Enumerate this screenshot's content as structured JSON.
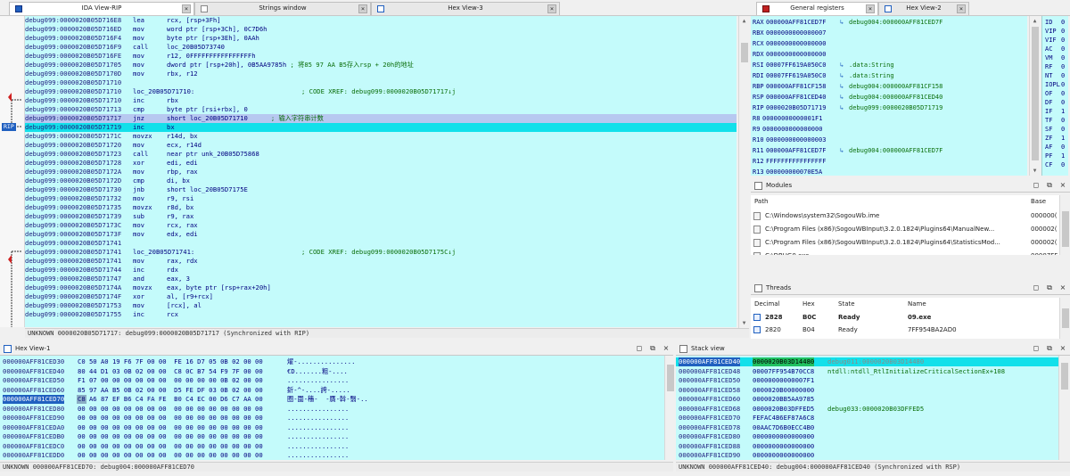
{
  "tabs_left": [
    {
      "label": "IDA View-RIP",
      "icon": "ida-view-icon",
      "active": true
    },
    {
      "label": "Strings window",
      "icon": "strings-icon",
      "active": false
    },
    {
      "label": "Hex View-3",
      "icon": "hex-view-icon",
      "active": false
    }
  ],
  "tabs_right": [
    {
      "label": "General registers",
      "icon": "registers-icon",
      "active": true
    },
    {
      "label": "Hex View-2",
      "icon": "hex-view-icon",
      "active": false
    }
  ],
  "gutter": {
    "rip_label": "RIP"
  },
  "disassembly": [
    {
      "addr": "debug099:0000020B05D716E8",
      "mn": "lea",
      "op": "rcx, [rsp+3Fh]"
    },
    {
      "addr": "debug099:0000020B05D716ED",
      "mn": "mov",
      "op": "word ptr [rsp+3Ch], 0C7D6h"
    },
    {
      "addr": "debug099:0000020B05D716F4",
      "mn": "mov",
      "op": "byte ptr [rsp+3Eh], 0AAh"
    },
    {
      "addr": "debug099:0000020B05D716F9",
      "mn": "call",
      "op": "loc_20B05D73740"
    },
    {
      "addr": "debug099:0000020B05D716FE",
      "mn": "mov",
      "op": "r12, 0FFFFFFFFFFFFFFFFh"
    },
    {
      "addr": "debug099:0000020B05D71705",
      "mn": "mov",
      "op": "dword ptr [rsp+20h], 0B5AA9785h ",
      "cm": "; 将85 97 AA B5存入rsp + 20h的地址"
    },
    {
      "addr": "debug099:0000020B05D7170D",
      "mn": "mov",
      "op": "rbx, r12"
    },
    {
      "addr": "debug099:0000020B05D71710",
      "mn": "",
      "op": ""
    },
    {
      "addr": "debug099:0000020B05D71710",
      "mn": "loc_20B05D71710:",
      "op": "",
      "cm": "; CODE XREF: debug099:0000020B05D71717↓j",
      "label": true
    },
    {
      "addr": "debug099:0000020B05D71710",
      "mn": "inc",
      "op": "rbx"
    },
    {
      "addr": "debug099:0000020B05D71713",
      "mn": "cmp",
      "op": "byte ptr [rsi+rbx], 0"
    },
    {
      "addr": "debug099:0000020B05D71717",
      "mn": "jnz",
      "op": "short loc_20B05D71710      ",
      "cm": "; 输入字符串计数",
      "sel": true
    },
    {
      "addr": "debug099:0000020B05D71719",
      "mn": "inc",
      "op": "bx",
      "hl": true
    },
    {
      "addr": "debug099:0000020B05D7171C",
      "mn": "movzx",
      "op": "r14d, bx"
    },
    {
      "addr": "debug099:0000020B05D71720",
      "mn": "mov",
      "op": "ecx, r14d"
    },
    {
      "addr": "debug099:0000020B05D71723",
      "mn": "call",
      "op": "near ptr unk_20B05D75868"
    },
    {
      "addr": "debug099:0000020B05D71728",
      "mn": "xor",
      "op": "edi, edi"
    },
    {
      "addr": "debug099:0000020B05D7172A",
      "mn": "mov",
      "op": "rbp, rax"
    },
    {
      "addr": "debug099:0000020B05D7172D",
      "mn": "cmp",
      "op": "di, bx"
    },
    {
      "addr": "debug099:0000020B05D71730",
      "mn": "jnb",
      "op": "short loc_20B05D7175E"
    },
    {
      "addr": "debug099:0000020B05D71732",
      "mn": "mov",
      "op": "r9, rsi"
    },
    {
      "addr": "debug099:0000020B05D71735",
      "mn": "movzx",
      "op": "r8d, bx"
    },
    {
      "addr": "debug099:0000020B05D71739",
      "mn": "sub",
      "op": "r9, rax"
    },
    {
      "addr": "debug099:0000020B05D7173C",
      "mn": "mov",
      "op": "rcx, rax"
    },
    {
      "addr": "debug099:0000020B05D7173F",
      "mn": "mov",
      "op": "edx, edi"
    },
    {
      "addr": "debug099:0000020B05D71741",
      "mn": "",
      "op": ""
    },
    {
      "addr": "debug099:0000020B05D71741",
      "mn": "loc_20B05D71741:",
      "op": "",
      "cm": "; CODE XREF: debug099:0000020B05D7175C↓j",
      "label": true
    },
    {
      "addr": "debug099:0000020B05D71741",
      "mn": "mov",
      "op": "rax, rdx"
    },
    {
      "addr": "debug099:0000020B05D71744",
      "mn": "inc",
      "op": "rdx"
    },
    {
      "addr": "debug099:0000020B05D71747",
      "mn": "and",
      "op": "eax, 3"
    },
    {
      "addr": "debug099:0000020B05D7174A",
      "mn": "movzx",
      "op": "eax, byte ptr [rsp+rax+20h]"
    },
    {
      "addr": "debug099:0000020B05D7174F",
      "mn": "xor",
      "op": "al, [r9+rcx]"
    },
    {
      "addr": "debug099:0000020B05D71753",
      "mn": "mov",
      "op": "[rcx], al"
    },
    {
      "addr": "debug099:0000020B05D71755",
      "mn": "inc",
      "op": "rcx"
    }
  ],
  "asm_status": "UNKNOWN 0000020B05D71717: debug099:0000020B05D71717 (Synchronized with RIP)",
  "registers": [
    {
      "name": "RAX",
      "value": "000000AFF81CED7F",
      "ref": "debug004:000000AFF81CED7F"
    },
    {
      "name": "RBX",
      "value": "0000000000000007",
      "ref": ""
    },
    {
      "name": "RCX",
      "value": "0000000000000000",
      "ref": ""
    },
    {
      "name": "RDX",
      "value": "0000000000000000",
      "ref": ""
    },
    {
      "name": "RSI",
      "value": "00007FF619A050C0",
      "ref": ".data:String"
    },
    {
      "name": "RDI",
      "value": "00007FF619A050C0",
      "ref": ".data:String"
    },
    {
      "name": "RBP",
      "value": "000000AFF81CF158",
      "ref": "debug004:000000AFF81CF158"
    },
    {
      "name": "RSP",
      "value": "000000AFF81CED40",
      "ref": "debug004:000000AFF81CED40"
    },
    {
      "name": "RIP",
      "value": "0000020B05D71719",
      "ref": "debug099:0000020B05D71719"
    },
    {
      "name": "R8",
      "value": "00000000000001F1",
      "ref": ""
    },
    {
      "name": "R9",
      "value": "0000000000000000",
      "ref": ""
    },
    {
      "name": "R10",
      "value": "0000000000000003",
      "ref": ""
    },
    {
      "name": "R11",
      "value": "000000AFF81CED7F",
      "ref": "debug004:000000AFF81CED7F"
    },
    {
      "name": "R12",
      "value": "FFFFFFFFFFFFFFFF",
      "ref": ""
    },
    {
      "name": "R13",
      "value": "000000000070E5A",
      "ref": ""
    }
  ],
  "flags": [
    {
      "name": "ID",
      "value": "0"
    },
    {
      "name": "VIP",
      "value": "0"
    },
    {
      "name": "VIF",
      "value": "0"
    },
    {
      "name": "AC",
      "value": "0"
    },
    {
      "name": "VM",
      "value": "0"
    },
    {
      "name": "RF",
      "value": "0"
    },
    {
      "name": "NT",
      "value": "0"
    },
    {
      "name": "IOPL",
      "value": "0"
    },
    {
      "name": "OF",
      "value": "0"
    },
    {
      "name": "DF",
      "value": "0"
    },
    {
      "name": "IF",
      "value": "1"
    },
    {
      "name": "TF",
      "value": "0"
    },
    {
      "name": "SF",
      "value": "0"
    },
    {
      "name": "ZF",
      "value": "1"
    },
    {
      "name": "AF",
      "value": "0"
    },
    {
      "name": "PF",
      "value": "1"
    },
    {
      "name": "CF",
      "value": "0"
    }
  ],
  "modules": {
    "title": "Modules",
    "col_path": "Path",
    "col_base": "Base",
    "rows": [
      {
        "path": "C:\\Windows\\system32\\SogouWb.ime",
        "base": "000000("
      },
      {
        "path": "C:\\Program Files (x86)\\SogouWBInput\\3.2.0.1824\\Plugins64\\ManualNew...",
        "base": "000002("
      },
      {
        "path": "C:\\Program Files (x86)\\SogouWBInput\\3.2.0.1824\\Plugins64\\StatisticsMod...",
        "base": "000002("
      },
      {
        "path": "C:\\DBUG0.exe",
        "base": "00007FF"
      }
    ]
  },
  "threads": {
    "title": "Threads",
    "col_decimal": "Decimal",
    "col_hex": "Hex",
    "col_state": "State",
    "col_name": "Name",
    "rows": [
      {
        "decimal": "2828",
        "hex": "B0C",
        "state": "Ready",
        "name": "09.exe",
        "bold": true
      },
      {
        "decimal": "2820",
        "hex": "B04",
        "state": "Ready",
        "name": "7FF954BA2AD0",
        "bold": false
      }
    ]
  },
  "hex_view": {
    "title": "Hex View-1",
    "rows": [
      {
        "addr": "000000AFF81CED30",
        "bytes": "C0 50 A0 19 F6 7F 00 00  FE 16 D7 05 0B 02 00 00",
        "ascii": "燿-..............."
      },
      {
        "addr": "000000AFF81CED40",
        "bytes": "80 44 D1 03 0B 02 00 00  C8 0C B7 54 F9 7F 00 00",
        "ascii": "€D.......粗-...."
      },
      {
        "addr": "000000AFF81CED50",
        "bytes": "F1 07 00 00 00 00 00 00  00 00 00 00 0B 02 00 00",
        "ascii": "................"
      },
      {
        "addr": "000000AFF81CED60",
        "bytes": "85 97 AA B5 0B 02 00 00  D5 FE DF 03 0B 02 00 00",
        "ascii": "釿-^-....誇-....."
      },
      {
        "addr": "000000AFF81CED70",
        "bytes": "C8 A6 87 EF B6 C4 FA FE  B0 C4 EC 00 D6 C7 AA 00",
        "ascii": "圈-圍-穡-  -贋-斡-翳-..",
        "cur": true
      },
      {
        "addr": "000000AFF81CED80",
        "bytes": "00 00 00 00 00 00 00 00  00 00 00 00 00 00 00 00",
        "ascii": "................"
      },
      {
        "addr": "000000AFF81CED90",
        "bytes": "00 00 00 00 00 00 00 00  00 00 00 00 00 00 00 00",
        "ascii": "................"
      },
      {
        "addr": "000000AFF81CEDA0",
        "bytes": "00 00 00 00 00 00 00 00  00 00 00 00 00 00 00 00",
        "ascii": "................"
      },
      {
        "addr": "000000AFF81CEDB0",
        "bytes": "00 00 00 00 00 00 00 00  00 00 00 00 00 00 00 00",
        "ascii": "................"
      },
      {
        "addr": "000000AFF81CEDC0",
        "bytes": "00 00 00 00 00 00 00 00  00 00 00 00 00 00 00 00",
        "ascii": "................"
      },
      {
        "addr": "000000AFF81CEDD0",
        "bytes": "00 00 00 00 00 00 00 00  00 00 00 00 00 00 00 00",
        "ascii": "................"
      }
    ],
    "status": "UNKNOWN 000000AFF81CED70: debug004:000000AFF81CED70"
  },
  "stack_view": {
    "title": "Stack view",
    "rows": [
      {
        "addr": "000000AFF81CED40",
        "value": "0000020B03D14480",
        "comment": "debug011:0000020B03D14480",
        "top": true
      },
      {
        "addr": "000000AFF81CED48",
        "value": "00007FF954B70CC8",
        "comment": "ntdll:ntdll_RtlInitializeCriticalSectionEx+108"
      },
      {
        "addr": "000000AFF81CED50",
        "value": "00000000000007F1",
        "comment": ""
      },
      {
        "addr": "000000AFF81CED58",
        "value": "0000020B00000000",
        "comment": ""
      },
      {
        "addr": "000000AFF81CED60",
        "value": "0000020BB5AA9785",
        "comment": ""
      },
      {
        "addr": "000000AFF81CED68",
        "value": "0000020B03DFFED5",
        "comment": "debug033:0000020B03DFFED5"
      },
      {
        "addr": "000000AFF81CED70",
        "value": "FEFAC4B6EF87A6C8",
        "comment": ""
      },
      {
        "addr": "000000AFF81CED78",
        "value": "00AAC7D6B0ECC4B0",
        "comment": ""
      },
      {
        "addr": "000000AFF81CED80",
        "value": "0000000000000000",
        "comment": ""
      },
      {
        "addr": "000000AFF81CED88",
        "value": "0000000000000000",
        "comment": ""
      },
      {
        "addr": "000000AFF81CED90",
        "value": "0000000000000000",
        "comment": ""
      }
    ],
    "status": "UNKNOWN 000000AFF81CED40: debug004:000000AFF81CED40 (Synchronized with RSP)"
  },
  "colors": {
    "bg_cyan": "#c4fbfb",
    "highlight": "#12e0ea",
    "comment_green": "#0a6e0a",
    "text_navy": "#000080"
  }
}
